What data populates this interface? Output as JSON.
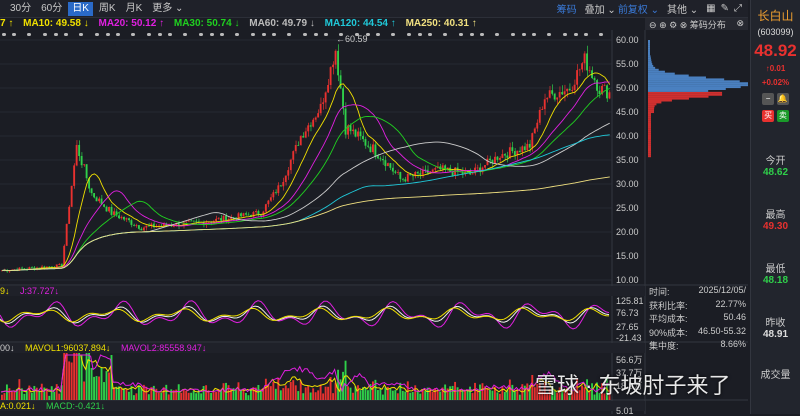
{
  "toolbar": {
    "tabs": [
      "30分",
      "60分",
      "日K",
      "周K",
      "月K",
      "更多 ⌄"
    ],
    "active": 2,
    "right": [
      "筹码",
      "叠加 ⌄",
      "前复权 ⌄",
      "其他 ⌄"
    ]
  },
  "ma": {
    "ma5": "7 ↑",
    "ma10": "MA10: 49.58 ↓",
    "ma20": "MA20: 50.12 ↑",
    "ma30": "MA30: 50.74 ↓",
    "ma60": "MA60: 49.79 ↓",
    "ma120": "MA120: 44.54 ↑",
    "ma250": "MA250: 40.31 ↑"
  },
  "chip": {
    "title": "筹码分布",
    "stats": [
      [
        "时间:",
        "2025/12/05/"
      ],
      [
        "获利比率:",
        "22.77%"
      ],
      [
        "平均成本:",
        "50.46"
      ],
      [
        "90%成本:",
        "46.50-55.32"
      ],
      [
        "集中度:",
        "8.66%"
      ]
    ]
  },
  "price_axis": [
    "60.00",
    "55.00",
    "50.00",
    "45.00",
    "40.00",
    "35.00",
    "30.00",
    "25.00",
    "20.00",
    "15.00",
    "10.00"
  ],
  "high_marker": "←60.59",
  "kdj": {
    "header_a": "9↓",
    "header_j": "J:37.727↓",
    "axis": [
      "125.81",
      "76.73",
      "27.65",
      "-21.43"
    ]
  },
  "vol": {
    "header_a": "00↓",
    "mavol1": "MAVOL1:96037.894↓",
    "mavol2": "MAVOL2:85558.947↓",
    "axis": [
      "56.6万",
      "37.7万",
      "18.9万"
    ]
  },
  "macd": {
    "header_a": "A:0.021↓",
    "macd": "MACD:-0.421↓",
    "axis": "5.01"
  },
  "side": {
    "name": "长白山",
    "code": "(603099)",
    "price": "48.92",
    "change": "↑0.01",
    "pct": "+0.02%",
    "open_l": "今开",
    "open": "48.62",
    "high_l": "最高",
    "high": "49.30",
    "low_l": "最低",
    "low": "48.18",
    "prev_l": "昨收",
    "prev": "48.91",
    "vol_l": "成交量",
    "buy": "买",
    "sell": "卖"
  },
  "watermark": "雪球 · 东坡肘子来了",
  "colors": {
    "up": "#e8312f",
    "down": "#2fd04a",
    "ma10": "#f0e000",
    "ma20": "#e020e0",
    "ma30": "#20d020",
    "ma60": "#cccccc",
    "ma120": "#20c8d8",
    "ma250": "#f0e080",
    "accent": "#2a6ac8"
  },
  "chart_data": {
    "type": "candlestick",
    "ylim": [
      10,
      60
    ],
    "price_path": [
      [
        0,
        12
      ],
      [
        24,
        13
      ],
      [
        30,
        38
      ],
      [
        36,
        28
      ],
      [
        44,
        24
      ],
      [
        56,
        21
      ],
      [
        80,
        22
      ],
      [
        104,
        24
      ],
      [
        112,
        30
      ],
      [
        120,
        40
      ],
      [
        128,
        46
      ],
      [
        134,
        58
      ],
      [
        138,
        42
      ],
      [
        152,
        36
      ],
      [
        160,
        31
      ],
      [
        176,
        33
      ],
      [
        188,
        32
      ],
      [
        200,
        36
      ],
      [
        212,
        38
      ],
      [
        218,
        48
      ],
      [
        228,
        50
      ],
      [
        234,
        56
      ],
      [
        240,
        50
      ],
      [
        244,
        49
      ]
    ]
  }
}
